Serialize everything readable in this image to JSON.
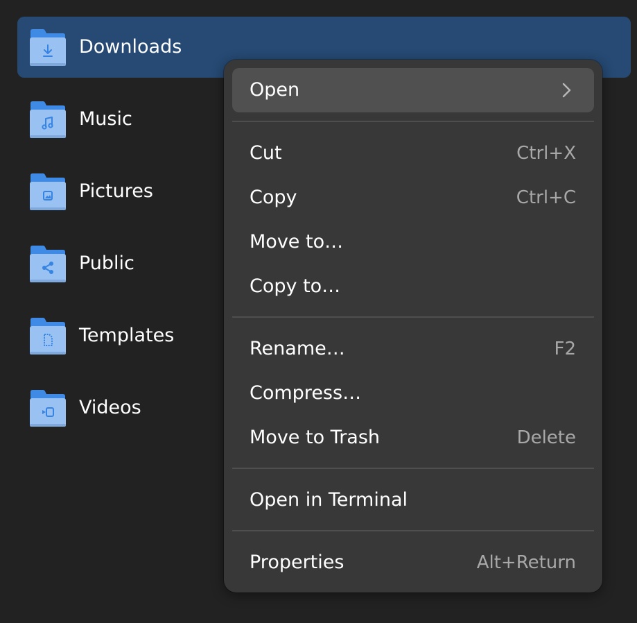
{
  "files": [
    {
      "name": "Downloads",
      "icon": "download-icon",
      "selected": true
    },
    {
      "name": "Music",
      "icon": "music-note-icon",
      "selected": false
    },
    {
      "name": "Pictures",
      "icon": "image-icon",
      "selected": false
    },
    {
      "name": "Public",
      "icon": "share-icon",
      "selected": false
    },
    {
      "name": "Templates",
      "icon": "document-icon",
      "selected": false
    },
    {
      "name": "Videos",
      "icon": "video-camera-icon",
      "selected": false
    }
  ],
  "context_menu": {
    "open": {
      "label": "Open",
      "icon": "chevron-right-icon"
    },
    "cut": {
      "label": "Cut",
      "shortcut": "Ctrl+X"
    },
    "copy": {
      "label": "Copy",
      "shortcut": "Ctrl+C"
    },
    "move_to": {
      "label": "Move to…"
    },
    "copy_to": {
      "label": "Copy to…"
    },
    "rename": {
      "label": "Rename…",
      "shortcut": "F2"
    },
    "compress": {
      "label": "Compress…"
    },
    "move_to_trash": {
      "label": "Move to Trash",
      "shortcut": "Delete"
    },
    "open_in_terminal": {
      "label": "Open in Terminal"
    },
    "properties": {
      "label": "Properties",
      "shortcut": "Alt+Return"
    }
  },
  "colors": {
    "background": "#222222",
    "selection": "#264a74",
    "menu_background": "#383838",
    "menu_hover": "#505050",
    "folder_body": "#99c1f1",
    "folder_tab": "#3f8ae5",
    "folder_glyph": "#3584e4"
  }
}
